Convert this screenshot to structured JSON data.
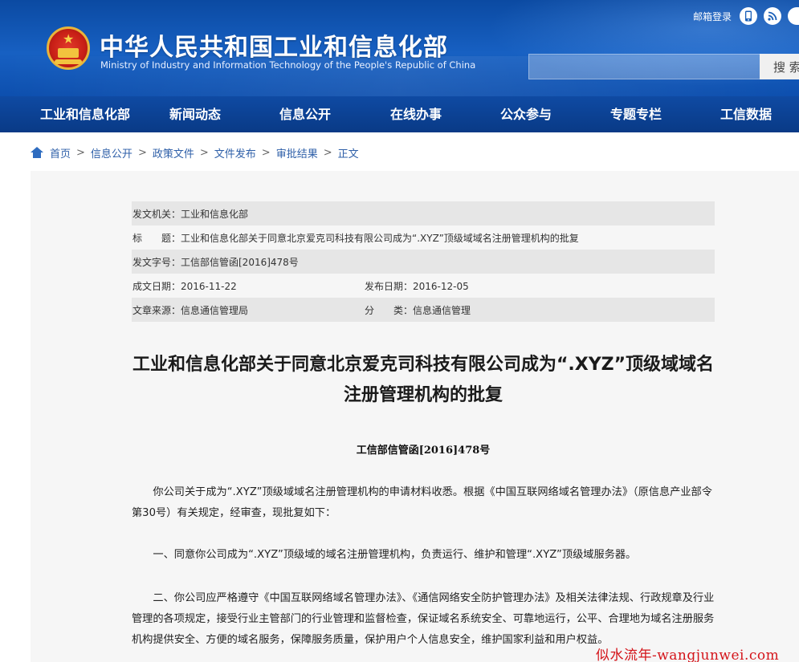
{
  "header": {
    "site_title": "中华人民共和国工业和信息化部",
    "site_subtitle": "Ministry of Industry and Information Technology of the People's Republic of China",
    "mail_login": "邮箱登录",
    "search_button": "搜 索",
    "icons": [
      "phone-icon",
      "rss-icon"
    ]
  },
  "nav": {
    "items": [
      "工业和信息化部",
      "新闻动态",
      "信息公开",
      "在线办事",
      "公众参与",
      "专题专栏",
      "工信数据"
    ]
  },
  "breadcrumb": {
    "items": [
      "首页",
      "信息公开",
      "政策文件",
      "文件发布",
      "审批结果",
      "正文"
    ]
  },
  "meta": {
    "issuer": "发文机关：工业和信息化部",
    "subject": "标　　题：工业和信息化部关于同意北京爱克司科技有限公司成为“.XYZ”顶级域域名注册管理机构的批复",
    "doc_no": "发文字号：工信部信管函[2016]478号",
    "created": "成文日期：2016-11-22",
    "published": "发布日期：2016-12-05",
    "source": "文章来源：信息通信管理局",
    "category": "分　　类：信息通信管理"
  },
  "document": {
    "title": "工业和信息化部关于同意北京爱克司科技有限公司成为“.XYZ”顶级域域名注册管理机构的批复",
    "number": "工信部信管函[2016]478号",
    "paragraphs": [
      "你公司关于成为“.XYZ”顶级域域名注册管理机构的申请材料收悉。根据《中国互联网络域名管理办法》（原信息产业部令第30号）有关规定，经审查，现批复如下：",
      "一、同意你公司成为“.XYZ”顶级域的域名注册管理机构，负责运行、维护和管理“.XYZ”顶级域服务器。",
      "二、你公司应严格遵守《中国互联网络域名管理办法》、《通信网络安全防护管理办法》及相关法律法规、行政规章及行业管理的各项规定，接受行业主管部门的行业管理和监督检查，保证域名系统安全、可靠地运行，公平、合理地为域名注册服务机构提供安全、方便的域名服务，保障服务质量，保护用户个人信息安全，维护国家利益和用户权益。"
    ]
  },
  "watermark": "似水流年-wangjunwei.com",
  "colors": {
    "header_blue": "#1760c2",
    "nav_blue": "#0c3f8f",
    "link_blue": "#2e5fa8",
    "panel_bg": "#f6f6f6",
    "watermark_red": "#d4141a"
  }
}
